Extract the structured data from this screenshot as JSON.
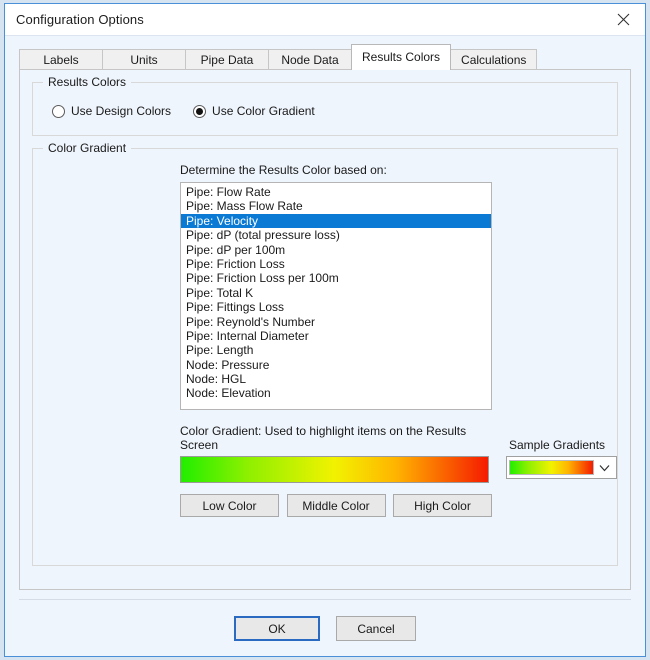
{
  "window": {
    "title": "Configuration Options",
    "close_icon": "close-icon"
  },
  "tabs": [
    {
      "label": "Labels",
      "active": false
    },
    {
      "label": "Units",
      "active": false
    },
    {
      "label": "Pipe Data",
      "active": false
    },
    {
      "label": "Node Data",
      "active": false
    },
    {
      "label": "Results Colors",
      "active": true
    },
    {
      "label": "Calculations",
      "active": false
    }
  ],
  "results_colors_group": {
    "title": "Results Colors",
    "options": [
      {
        "label": "Use Design Colors",
        "checked": false
      },
      {
        "label": "Use Color Gradient",
        "checked": true
      }
    ]
  },
  "color_gradient_group": {
    "title": "Color Gradient",
    "list_caption": "Determine the Results Color based on:",
    "list_items": [
      {
        "label": "Pipe: Flow Rate",
        "selected": false
      },
      {
        "label": "Pipe: Mass Flow Rate",
        "selected": false
      },
      {
        "label": "Pipe: Velocity",
        "selected": true
      },
      {
        "label": "Pipe: dP (total pressure loss)",
        "selected": false
      },
      {
        "label": "Pipe: dP per 100m",
        "selected": false
      },
      {
        "label": "Pipe: Friction Loss",
        "selected": false
      },
      {
        "label": "Pipe: Friction Loss per 100m",
        "selected": false
      },
      {
        "label": "Pipe: Total K",
        "selected": false
      },
      {
        "label": "Pipe: Fittings Loss",
        "selected": false
      },
      {
        "label": "Pipe: Reynold's Number",
        "selected": false
      },
      {
        "label": "Pipe: Internal Diameter",
        "selected": false
      },
      {
        "label": "Pipe: Length",
        "selected": false
      },
      {
        "label": "Node: Pressure",
        "selected": false
      },
      {
        "label": "Node: HGL",
        "selected": false
      },
      {
        "label": "Node: Elevation",
        "selected": false
      }
    ],
    "gradient_caption": "Color Gradient: Used to highlight items on the Results Screen",
    "sample_caption": "Sample Gradients",
    "sample_dropdown_icon": "chevron-down-icon",
    "gradient_colors": {
      "low": "#22ee00",
      "middle": "#f2f200",
      "high": "#f51b00"
    },
    "color_buttons": [
      {
        "label": "Low Color"
      },
      {
        "label": "Middle Color"
      },
      {
        "label": "High Color"
      }
    ]
  },
  "footer": {
    "ok_label": "OK",
    "cancel_label": "Cancel"
  },
  "theme": {
    "selection_blue": "#0a7ad4",
    "window_border": "#4a90d9",
    "page_background": "#eff5fd"
  }
}
